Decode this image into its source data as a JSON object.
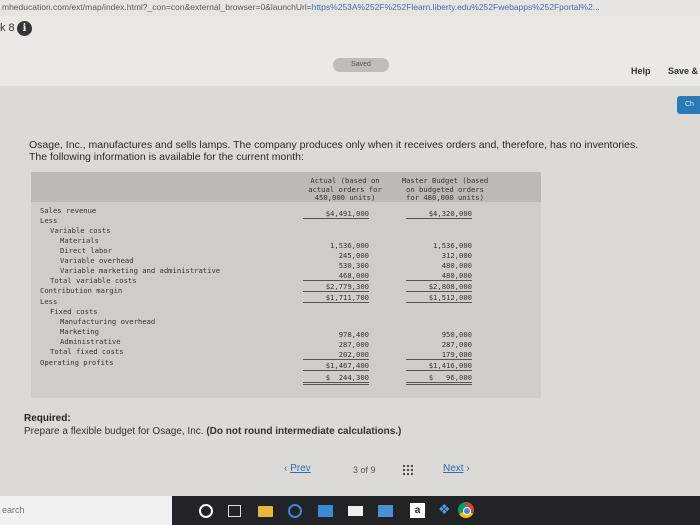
{
  "browser": {
    "url_prefix": "mheducation.com/ext/map/index.html?_con=con&external_browser=0&launchUrl=",
    "url_link": "https%253A%252F%252Flearn.liberty.edu%252Fwebapps%252Fportal%2..."
  },
  "header": {
    "question_number": "k 8",
    "info_icon": "i",
    "saved_label": "Saved",
    "help_label": "Help",
    "save_exit_label": "Save &",
    "check_label": "Ch"
  },
  "question": {
    "line1": "Osage, Inc., manufactures and sells lamps. The company produces only when it receives orders and, therefore, has no inventories.",
    "line2": "The following information is available for the current month:"
  },
  "table": {
    "col_actual": [
      "Actual (based on",
      "actual orders for",
      "450,000 units)"
    ],
    "col_master": [
      "Master Budget (based",
      "on budgeted orders",
      "for 480,000 units)"
    ],
    "sales_revenue": {
      "label": "Sales revenue",
      "actual": "$4,491,000",
      "master": "$4,320,000"
    },
    "less1": "Less",
    "variable_costs": "Variable costs",
    "materials": {
      "label": "Materials",
      "actual": "1,536,000",
      "master": "1,536,000"
    },
    "direct_labor": {
      "label": "Direct labor",
      "actual": "245,000",
      "master": "312,000"
    },
    "variable_overhead": {
      "label": "Variable overhead",
      "actual": "530,300",
      "master": "480,000"
    },
    "variable_marketing": {
      "label": "Variable marketing and administrative",
      "actual": "468,000",
      "master": "480,000"
    },
    "total_variable": {
      "label": "Total variable costs",
      "actual": "$2,779,300",
      "master": "$2,808,000"
    },
    "contribution_margin": {
      "label": "Contribution margin",
      "actual": "$1,711,700",
      "master": "$1,512,000"
    },
    "less2": "Less",
    "fixed_costs": "Fixed costs",
    "mfg_overhead": {
      "label": "Manufacturing overhead",
      "actual": "978,400",
      "master": "950,000"
    },
    "marketing": {
      "label": "Marketing",
      "actual": "287,000",
      "master": "287,000"
    },
    "administrative": {
      "label": "Administrative",
      "actual": "202,000",
      "master": "179,000"
    },
    "total_fixed": {
      "label": "Total fixed costs",
      "actual": "$1,467,400",
      "master": "$1,416,000"
    },
    "operating_profits": {
      "label": "Operating profits",
      "actual": "$  244,300",
      "master": "$   96,000"
    }
  },
  "required": {
    "title": "Required:",
    "text": "Prepare a flexible budget for Osage, Inc.",
    "bold": "(Do not round intermediate calculations.)"
  },
  "pagination": {
    "prev_label": "Prev",
    "page_current": "3",
    "page_of": "of 9",
    "next_label": "Next"
  },
  "taskbar": {
    "search_placeholder": "earch",
    "amazon_glyph": "a"
  }
}
